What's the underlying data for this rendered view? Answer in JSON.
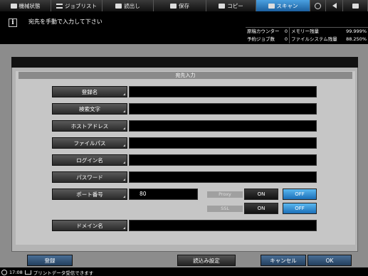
{
  "tabs": [
    "機械状態",
    "ジョブリスト",
    "読出し",
    "保存",
    "コピー",
    "スキャン"
  ],
  "message": "宛先を手動で入力して下さい",
  "stats": {
    "counter_label": "原稿カウンター",
    "counter_value": "0",
    "memory_label": "メモリー残量",
    "memory_value": "99.999%",
    "reserve_label": "予約ジョブ数",
    "reserve_value": "0",
    "fs_label": "ファイルシステム残量",
    "fs_value": "88.250%"
  },
  "panel_title": "宛先入力",
  "fields": {
    "reg_name": "登録名",
    "search": "検索文字",
    "host": "ホストアドレス",
    "path": "ファイルパス",
    "login": "ログイン名",
    "password": "パスワード",
    "port": "ポート番号",
    "port_value": "80",
    "domain": "ドメイン名"
  },
  "proxy": {
    "label": "Proxy",
    "on": "ON",
    "off": "OFF",
    "selected": "OFF"
  },
  "ssl": {
    "label": "SSL",
    "on": "ON",
    "off": "OFF",
    "selected": "OFF"
  },
  "buttons": {
    "register": "登録",
    "read_settings": "読込み設定",
    "cancel": "キャンセル",
    "ok": "OK"
  },
  "status": {
    "time": "17:08",
    "text": "プリントデータ受信できます"
  },
  "colors": {
    "accent": "#2a8ad8",
    "panel": "#c6c6c6"
  }
}
